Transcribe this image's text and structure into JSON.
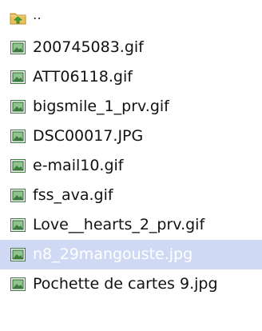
{
  "file_list": {
    "parent_dir": {
      "label": "..",
      "icon": "folder-up-icon"
    },
    "items": [
      {
        "name": "200745083.gif",
        "icon": "image-file-icon",
        "selected": false
      },
      {
        "name": "ATT06118.gif",
        "icon": "image-file-icon",
        "selected": false
      },
      {
        "name": "bigsmile_1_prv.gif",
        "icon": "image-file-icon",
        "selected": false
      },
      {
        "name": "DSC00017.JPG",
        "icon": "image-file-icon",
        "selected": false
      },
      {
        "name": "e-mail10.gif",
        "icon": "image-file-icon",
        "selected": false
      },
      {
        "name": "fss_ava.gif",
        "icon": "image-file-icon",
        "selected": false
      },
      {
        "name": "Love__hearts_2_prv.gif",
        "icon": "image-file-icon",
        "selected": false
      },
      {
        "name": "n8_29mangouste.jpg",
        "icon": "image-file-icon",
        "selected": true
      },
      {
        "name": "Pochette de cartes 9.jpg",
        "icon": "image-file-icon",
        "selected": false
      }
    ],
    "colors": {
      "selection_bg": "#cfd9f4",
      "selection_text": "#ffffff",
      "text": "#111111",
      "folder": "#e9c15a",
      "arrow": "#3aa63a",
      "image_frame": "#3d7a3d",
      "image_fill": "#8fc48f"
    }
  }
}
